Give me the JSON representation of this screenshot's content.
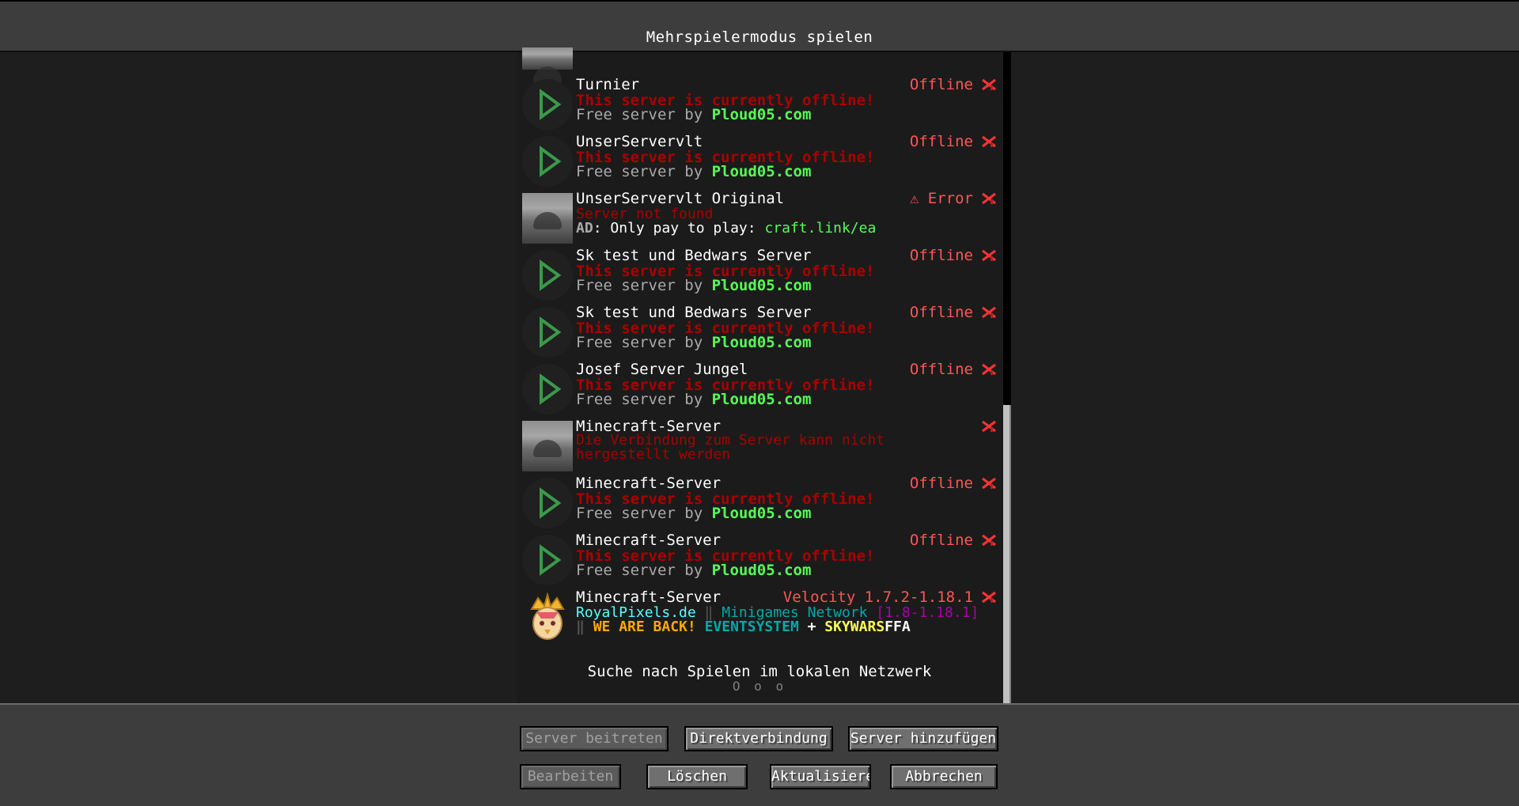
{
  "title": "Mehrspielermodus spielen",
  "servers": [
    {
      "name": "Turnier",
      "status": "Offline",
      "motd1": "This server is currently offline!",
      "motd2_prefix": "Free server by ",
      "motd2_link": "Ploud05.com",
      "icon": "play-icon"
    },
    {
      "name": "UnserServervlt",
      "status": "Offline",
      "motd1": "This server is currently offline!",
      "motd2_prefix": "Free server by ",
      "motd2_link": "Ploud05.com",
      "icon": "play-icon"
    },
    {
      "name": "UnserServervlt Original",
      "status": "⚠ Error",
      "motd1": "Server not found",
      "ad_label": "AD",
      "ad_text": ": Only pay to play: ",
      "ad_link": "craft.link/ea",
      "icon": "stone-icon"
    },
    {
      "name": "Sk test und Bedwars Server",
      "status": "Offline",
      "motd1": "This server is currently offline!",
      "motd2_prefix": "Free server by ",
      "motd2_link": "Ploud05.com",
      "icon": "play-icon"
    },
    {
      "name": "Sk test und Bedwars Server",
      "status": "Offline",
      "motd1": "This server is currently offline!",
      "motd2_prefix": "Free server by ",
      "motd2_link": "Ploud05.com",
      "icon": "play-icon"
    },
    {
      "name": "Josef Server Jungel",
      "status": "Offline",
      "motd1": "This server is currently offline!",
      "motd2_prefix": "Free server by ",
      "motd2_link": "Ploud05.com",
      "icon": "play-icon"
    },
    {
      "name": "Minecraft-Server",
      "status": "",
      "motd1": "Die Verbindung zum Server kann nicht hergestellt werden",
      "icon": "stone-icon"
    },
    {
      "name": "Minecraft-Server",
      "status": "Offline",
      "motd1": "This server is currently offline!",
      "motd2_prefix": "Free server by ",
      "motd2_link": "Ploud05.com",
      "icon": "play-icon"
    },
    {
      "name": "Minecraft-Server",
      "status": "Offline",
      "motd1": "This server is currently offline!",
      "motd2_prefix": "Free server by ",
      "motd2_link": "Ploud05.com",
      "icon": "play-icon"
    },
    {
      "name": "Minecraft-Server",
      "status": "Velocity 1.7.2-1.18.1",
      "rp_site": "RoyalPixels.de",
      "rp_sep": " ‖ ",
      "rp_network": "Minigames Network",
      "rp_version": " [1.8-1.18.1]",
      "rp_sep2": "‖ ",
      "rp_back": "WE ARE BACK!",
      "rp_event": " EVENTSYSTEM",
      "rp_plus": " + ",
      "rp_sky": "SKYWARS",
      "rp_ffa": "FFA",
      "icon": "crown-icon"
    }
  ],
  "lan": {
    "text": "Suche nach Spielen im lokalen Netzwerk",
    "dots": "O o o"
  },
  "buttons": {
    "join": "Server beitreten",
    "direct": "Direktverbindung",
    "add": "Server hinzufügen",
    "edit": "Bearbeiten",
    "delete": "Löschen",
    "refresh": "Aktualisieren",
    "cancel": "Abbrechen"
  },
  "colors": {
    "offline": "#ff5555",
    "motd_error": "#aa0000",
    "link_green": "#55ff55",
    "header_bg": "#3d3d3d"
  }
}
